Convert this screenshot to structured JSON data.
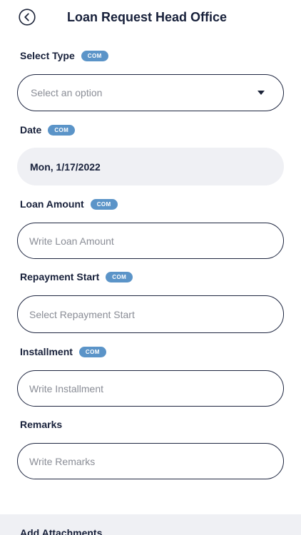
{
  "header": {
    "title": "Loan Request Head Office",
    "back_icon": "back-arrow-circle-icon"
  },
  "form": {
    "type": {
      "label": "Select Type",
      "badge": "COM",
      "placeholder": "Select an option",
      "icon": "dropdown-caret-icon"
    },
    "date": {
      "label": "Date",
      "badge": "COM",
      "value": "Mon, 1/17/2022"
    },
    "loan_amount": {
      "label": "Loan Amount",
      "badge": "COM",
      "placeholder": "Write Loan Amount"
    },
    "repayment_start": {
      "label": "Repayment Start",
      "badge": "COM",
      "placeholder": "Select Repayment Start"
    },
    "installment": {
      "label": "Installment",
      "badge": "COM",
      "placeholder": "Write Installment"
    },
    "remarks": {
      "label": "Remarks",
      "placeholder": "Write Remarks"
    }
  },
  "attachments": {
    "title": "Add Attachments"
  },
  "colors": {
    "badge": "#5b94c8",
    "border": "#1e2640",
    "date_background": "#eff0f4",
    "text": "#17203a"
  }
}
